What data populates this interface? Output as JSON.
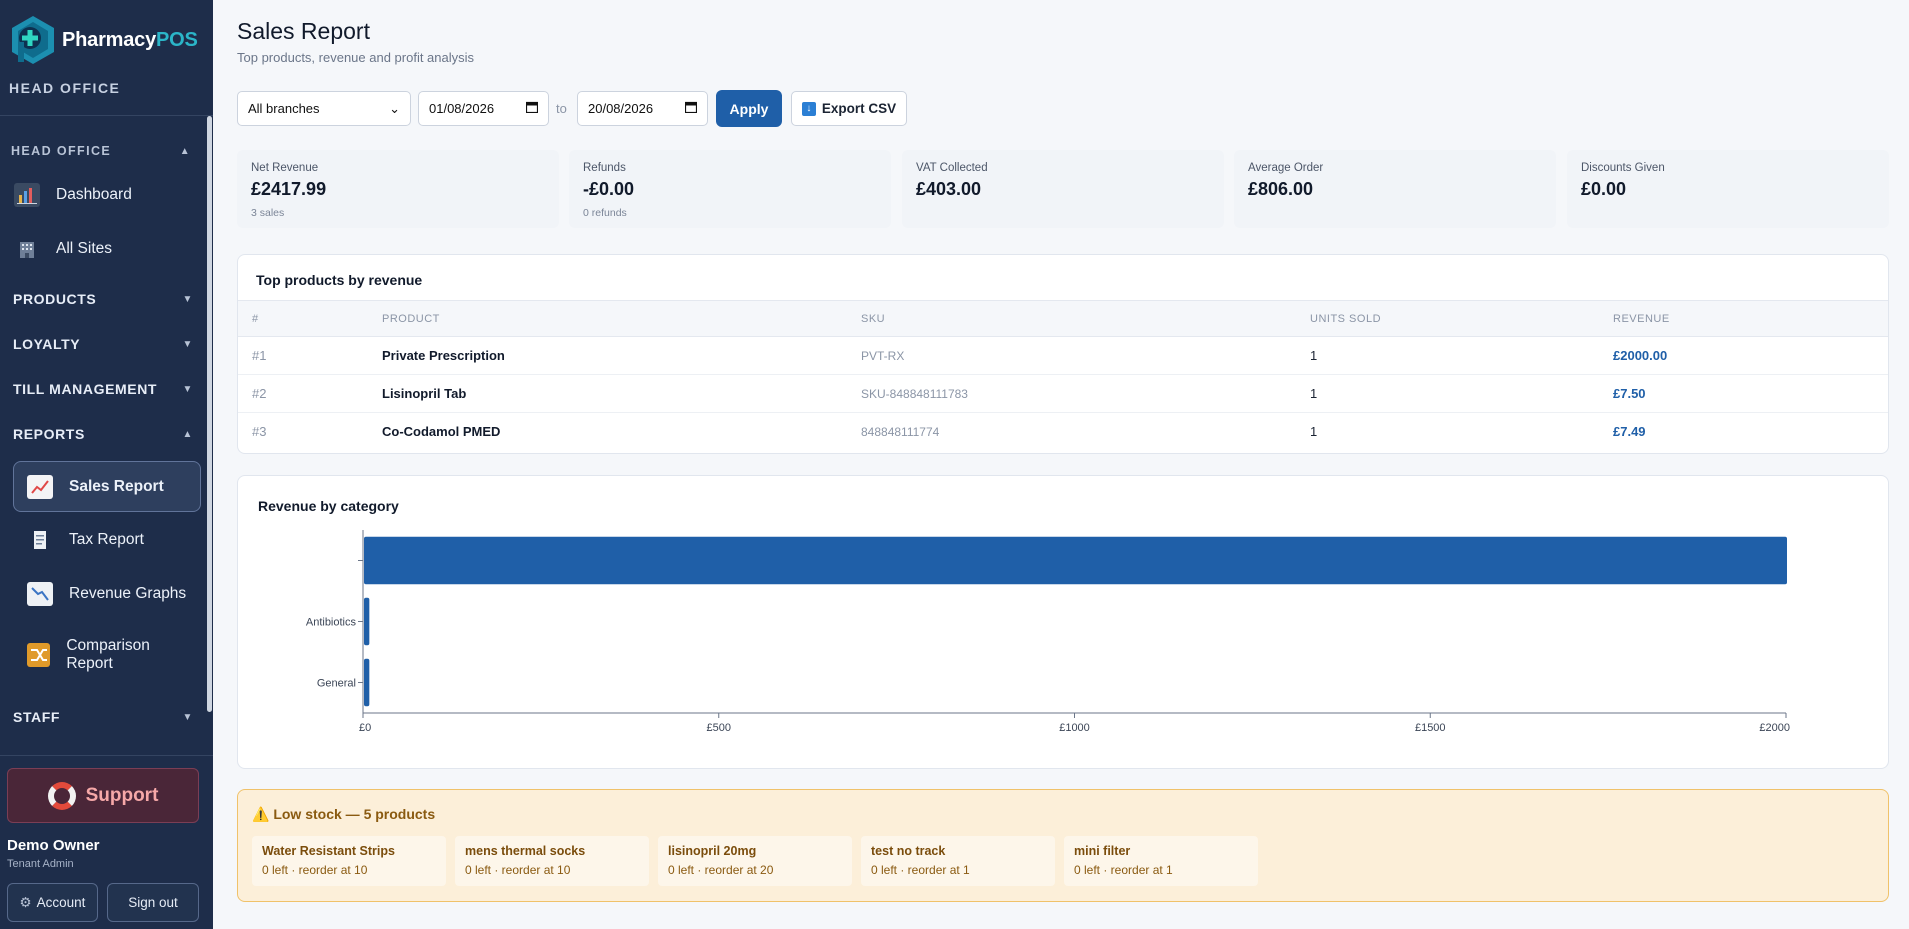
{
  "app": {
    "name_main": "Pharmacy",
    "name_accent": "POS",
    "tenant": "HEAD OFFICE"
  },
  "sidebar": {
    "group_head_office": "HEAD OFFICE",
    "dashboard": "Dashboard",
    "all_sites": "All Sites",
    "products": "PRODUCTS",
    "loyalty": "LOYALTY",
    "till_management": "TILL MANAGEMENT",
    "reports": "REPORTS",
    "sales_report": "Sales Report",
    "tax_report": "Tax Report",
    "revenue_graphs": "Revenue Graphs",
    "comparison_report": "Comparison Report",
    "staff": "STAFF",
    "support": "Support",
    "user_name": "Demo Owner",
    "user_role": "Tenant Admin",
    "account": "Account",
    "sign_out": "Sign out"
  },
  "header": {
    "title": "Sales Report",
    "subtitle": "Top products, revenue and profit analysis"
  },
  "filters": {
    "branch": "All branches",
    "date_from": "01/08/2026",
    "to_label": "to",
    "date_to": "20/08/2026",
    "apply": "Apply",
    "export": "Export CSV"
  },
  "stats": [
    {
      "label": "Net Revenue",
      "value": "£2417.99",
      "sub": "3 sales"
    },
    {
      "label": "Refunds",
      "value": "-£0.00",
      "sub": "0 refunds"
    },
    {
      "label": "VAT Collected",
      "value": "£403.00",
      "sub": ""
    },
    {
      "label": "Average Order",
      "value": "£806.00",
      "sub": ""
    },
    {
      "label": "Discounts Given",
      "value": "£0.00",
      "sub": ""
    }
  ],
  "top_products": {
    "title": "Top products by revenue",
    "columns": [
      "#",
      "PRODUCT",
      "SKU",
      "UNITS SOLD",
      "REVENUE"
    ],
    "rows": [
      {
        "rank": "#1",
        "product": "Private Prescription",
        "sku": "PVT-RX",
        "units": "1",
        "revenue": "£2000.00"
      },
      {
        "rank": "#2",
        "product": "Lisinopril Tab",
        "sku": "SKU-848848111783",
        "units": "1",
        "revenue": "£7.50"
      },
      {
        "rank": "#3",
        "product": "Co-Codamol PMED",
        "sku": "848848111774",
        "units": "1",
        "revenue": "£7.49"
      }
    ]
  },
  "chart_title": "Revenue by category",
  "chart_data": {
    "type": "bar",
    "orientation": "horizontal",
    "categories": [
      "",
      "Antibiotics",
      "General"
    ],
    "values": [
      2000,
      7.5,
      7.49
    ],
    "xlim": [
      0,
      2000
    ],
    "xticks": [
      "£0",
      "£500",
      "£1000",
      "£1500",
      "£2000"
    ],
    "xtick_values": [
      0,
      500,
      1000,
      1500,
      2000
    ],
    "bar_color": "#1f5fa8"
  },
  "low_stock": {
    "title": "Low stock — 5 products",
    "items": [
      {
        "name": "Water Resistant Strips",
        "detail": "0 left · reorder at 10"
      },
      {
        "name": "mens thermal socks",
        "detail": "0 left · reorder at 10"
      },
      {
        "name": "lisinopril 20mg",
        "detail": "0 left · reorder at 20"
      },
      {
        "name": "test no track",
        "detail": "0 left · reorder at 1"
      },
      {
        "name": "mini filter",
        "detail": "0 left · reorder at 1"
      }
    ]
  }
}
